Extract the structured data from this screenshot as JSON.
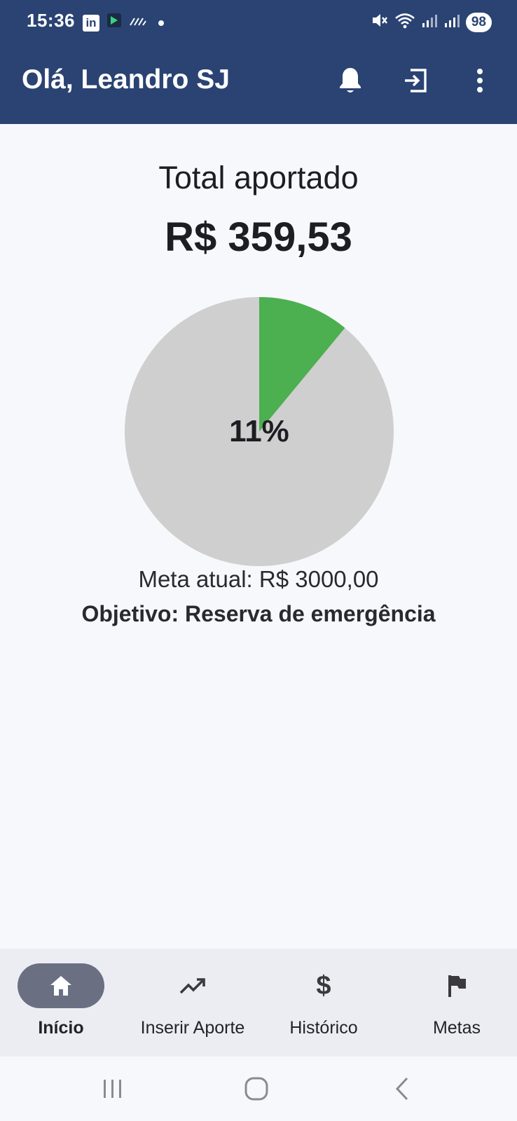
{
  "status_bar": {
    "time": "15:36",
    "battery": "98",
    "icons": [
      "linkedin-icon",
      "app-icon",
      "signal-icon",
      "mute-icon",
      "wifi-icon",
      "cell-signal-icon"
    ]
  },
  "app_bar": {
    "greeting": "Olá, Leandro SJ",
    "actions": [
      "bell-icon",
      "logout-icon",
      "more-vert-icon"
    ]
  },
  "summary": {
    "title": "Total aportado",
    "amount": "R$ 359,53",
    "progress_percent": 11,
    "progress_label": "11%",
    "meta_label": "Meta atual: R$ 3000,00",
    "objective_label": "Objetivo: Reserva de emergência"
  },
  "colors": {
    "app_bar": "#2a4373",
    "progress_fill": "#4caf50",
    "progress_track": "#cfcfcf",
    "nav_active_pill": "#6b6f82"
  },
  "bottom_nav": {
    "items": [
      {
        "label": "Início",
        "icon": "home-icon",
        "active": true
      },
      {
        "label": "Inserir Aporte",
        "icon": "trending-up-icon",
        "active": false
      },
      {
        "label": "Histórico",
        "icon": "dollar-icon",
        "active": false
      },
      {
        "label": "Metas",
        "icon": "flag-icon",
        "active": false
      }
    ]
  },
  "system_nav": [
    "recents-button",
    "home-button",
    "back-button"
  ]
}
